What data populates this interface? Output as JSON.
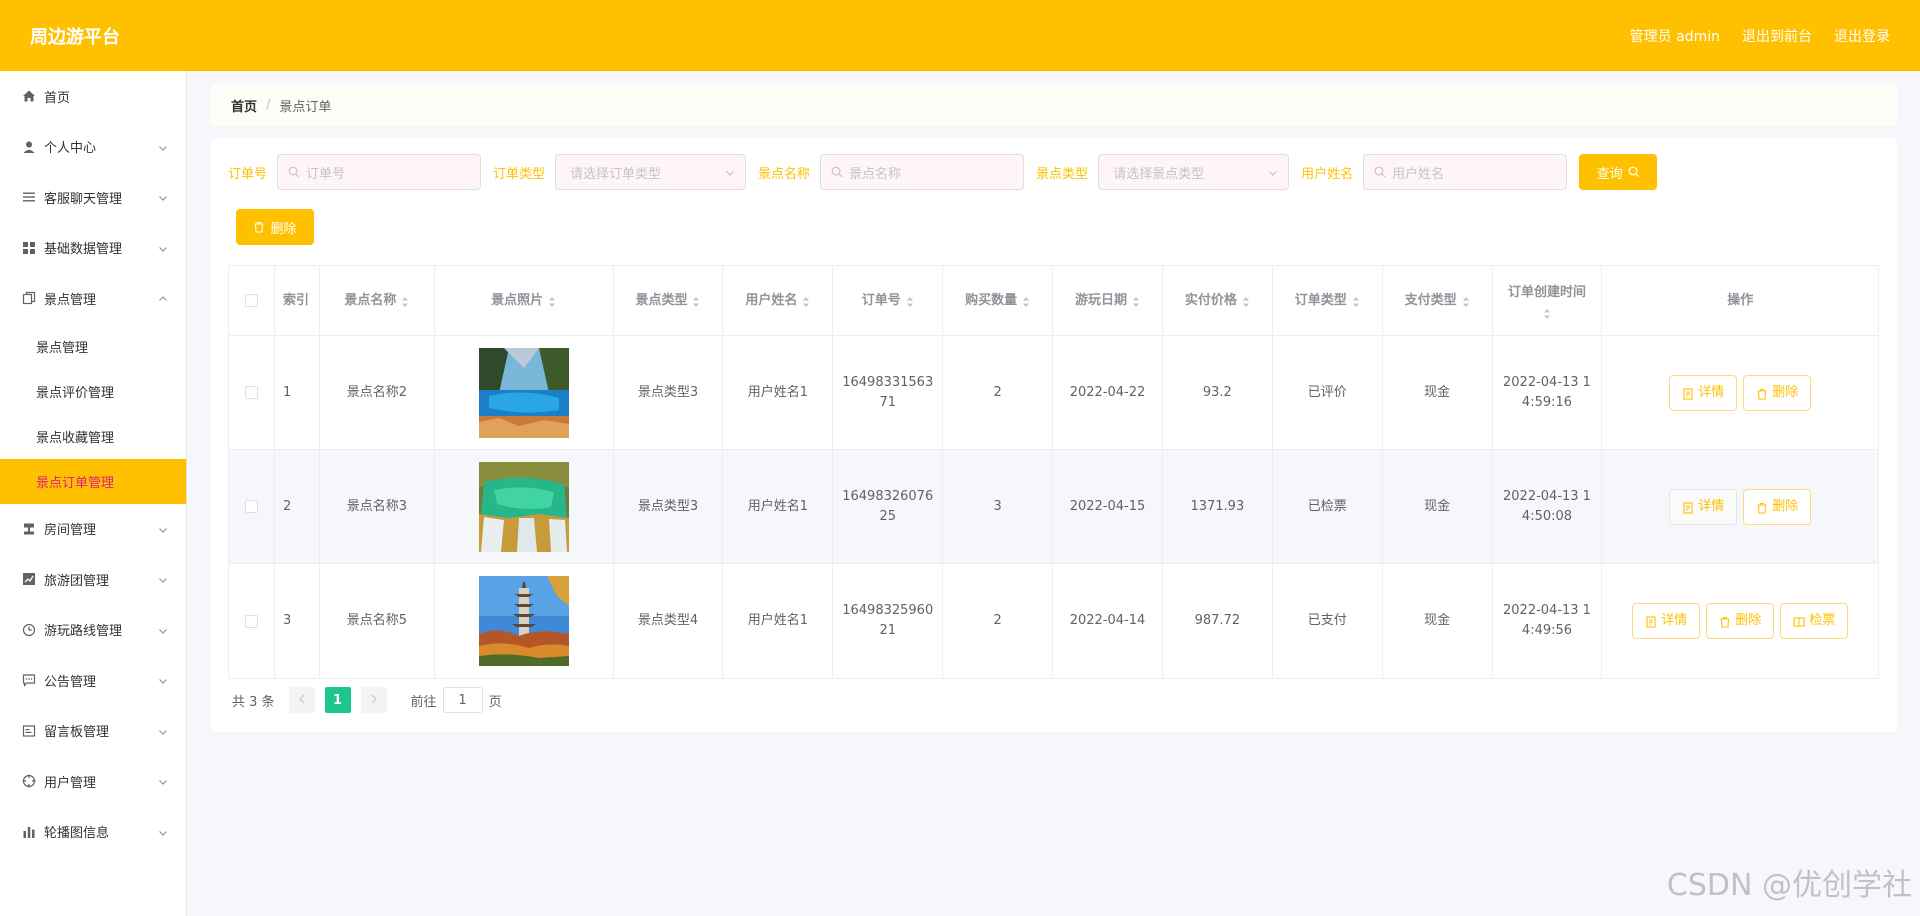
{
  "header": {
    "brand": "周边游平台",
    "user": "管理员 admin",
    "back_front": "退出到前台",
    "logout": "退出登录"
  },
  "sidebar": {
    "items": [
      {
        "label": "首页",
        "icon": "home-icon",
        "has_children": false
      },
      {
        "label": "个人中心",
        "icon": "user-icon",
        "has_children": true
      },
      {
        "label": "客服聊天管理",
        "icon": "list-icon",
        "has_children": true
      },
      {
        "label": "基础数据管理",
        "icon": "grid-icon",
        "has_children": true
      },
      {
        "label": "景点管理",
        "icon": "copy-icon",
        "has_children": true,
        "expanded": true
      }
    ],
    "sub_items": [
      {
        "label": "景点管理",
        "active": false
      },
      {
        "label": "景点评价管理",
        "active": false
      },
      {
        "label": "景点收藏管理",
        "active": false
      },
      {
        "label": "景点订单管理",
        "active": true
      }
    ],
    "items_after": [
      {
        "label": "房间管理",
        "icon": "stamp-icon"
      },
      {
        "label": "旅游团管理",
        "icon": "chart-icon"
      },
      {
        "label": "游玩路线管理",
        "icon": "clock-icon"
      },
      {
        "label": "公告管理",
        "icon": "chat-icon"
      },
      {
        "label": "留言板管理",
        "icon": "message-icon"
      },
      {
        "label": "用户管理",
        "icon": "target-icon"
      },
      {
        "label": "轮播图信息",
        "icon": "bar-chart-icon"
      }
    ]
  },
  "breadcrumb": {
    "home": "首页",
    "sep": "/",
    "current": "景点订单"
  },
  "search": {
    "order_no_label": "订单号",
    "order_no_placeholder": "订单号",
    "order_type_label": "订单类型",
    "order_type_placeholder": "请选择订单类型",
    "spot_name_label": "景点名称",
    "spot_name_placeholder": "景点名称",
    "spot_type_label": "景点类型",
    "spot_type_placeholder": "请选择景点类型",
    "user_name_label": "用户姓名",
    "user_name_placeholder": "用户姓名",
    "query_button": "查询"
  },
  "toolbar": {
    "batch_delete": "删除"
  },
  "table": {
    "headers": [
      "索引",
      "景点名称",
      "景点照片",
      "景点类型",
      "用户姓名",
      "订单号",
      "购买数量",
      "游玩日期",
      "实付价格",
      "订单类型",
      "支付类型",
      "订单创建时间",
      "操作"
    ],
    "rows": [
      {
        "index": "1",
        "spot_name": "景点名称2",
        "photo": "lake-photo",
        "spot_type": "景点类型3",
        "user_name": "用户姓名1",
        "order_no": "1649833156371",
        "quantity": "2",
        "play_date": "2022-04-22",
        "price": "93.2",
        "order_type": "已评价",
        "pay_type": "现金",
        "created": "2022-04-13 14:59:16",
        "actions": [
          "详情",
          "删除"
        ]
      },
      {
        "index": "2",
        "spot_name": "景点名称3",
        "photo": "waterfall-photo",
        "spot_type": "景点类型3",
        "user_name": "用户姓名1",
        "order_no": "1649832607625",
        "quantity": "3",
        "play_date": "2022-04-15",
        "price": "1371.93",
        "order_type": "已检票",
        "pay_type": "现金",
        "created": "2022-04-13 14:50:08",
        "actions": [
          "详情",
          "删除"
        ]
      },
      {
        "index": "3",
        "spot_name": "景点名称5",
        "photo": "pagoda-photo",
        "spot_type": "景点类型4",
        "user_name": "用户姓名1",
        "order_no": "1649832596021",
        "quantity": "2",
        "play_date": "2022-04-14",
        "price": "987.72",
        "order_type": "已支付",
        "pay_type": "现金",
        "created": "2022-04-13 14:49:56",
        "actions": [
          "详情",
          "删除",
          "检票"
        ]
      }
    ]
  },
  "pager": {
    "total": "共 3 条",
    "current": "1",
    "goto_prefix": "前往",
    "goto_value": "1",
    "goto_suffix": "页"
  },
  "watermark": "CSDN @优创学社",
  "colors": {
    "accent": "#ffc000",
    "active_text": "#e01e7c",
    "page_active": "#1ec58e"
  }
}
